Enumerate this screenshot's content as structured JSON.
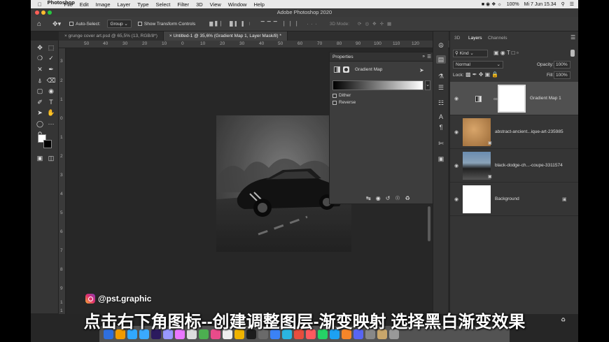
{
  "mac_menu": {
    "app_name": "Photoshop",
    "items": [
      "File",
      "Edit",
      "Image",
      "Layer",
      "Type",
      "Select",
      "Filter",
      "3D",
      "View",
      "Window",
      "Help"
    ],
    "battery": "100%",
    "clock": "Mi 7 Jun  15.34"
  },
  "window_title": "Adobe Photoshop 2020",
  "options_bar": {
    "auto_select_label": "Auto-Select:",
    "auto_select_value": "Group",
    "show_transform_label": "Show Transform Controls",
    "mode_3d_label": "3D Mode:"
  },
  "doc_tabs": [
    {
      "label": "grunge cover art.psd @ 65,5% (13, RGB/8*)"
    },
    {
      "label": "Untitled-1 @ 35,6% (Gradient Map 1, Layer Mask/8) *"
    }
  ],
  "ruler": {
    "h_ticks": [
      "50",
      "40",
      "30",
      "20",
      "10",
      "0",
      "10",
      "20",
      "30",
      "40",
      "50",
      "60",
      "70",
      "80",
      "90",
      "100",
      "110",
      "120"
    ],
    "v_ticks": [
      "3",
      "2",
      "1",
      "0",
      "1",
      "2",
      "3",
      "4",
      "5",
      "6",
      "7",
      "8",
      "9",
      "1",
      "1"
    ]
  },
  "properties": {
    "title": "Properties",
    "adjustment_name": "Gradient Map",
    "dither_label": "Dither",
    "reverse_label": "Reverse"
  },
  "layers_panel": {
    "tabs": [
      "3D",
      "Layers",
      "Channels"
    ],
    "filter_kind": "Kind",
    "blend_mode": "Normal",
    "opacity_label": "Opacity:",
    "opacity_value": "100%",
    "lock_label": "Lock:",
    "fill_label": "Fill:",
    "fill_value": "100%",
    "layers": [
      {
        "name": "Gradient Map 1"
      },
      {
        "name": "abstract-ancient...ique-art-235985"
      },
      {
        "name": "black-dodge-ch...-coupe-3311574"
      },
      {
        "name": "Background"
      }
    ]
  },
  "watermark": "@pst.graphic",
  "subtitle": "点击右下角图标--创建调整图层-渐变映射 选择黑白渐变效果"
}
